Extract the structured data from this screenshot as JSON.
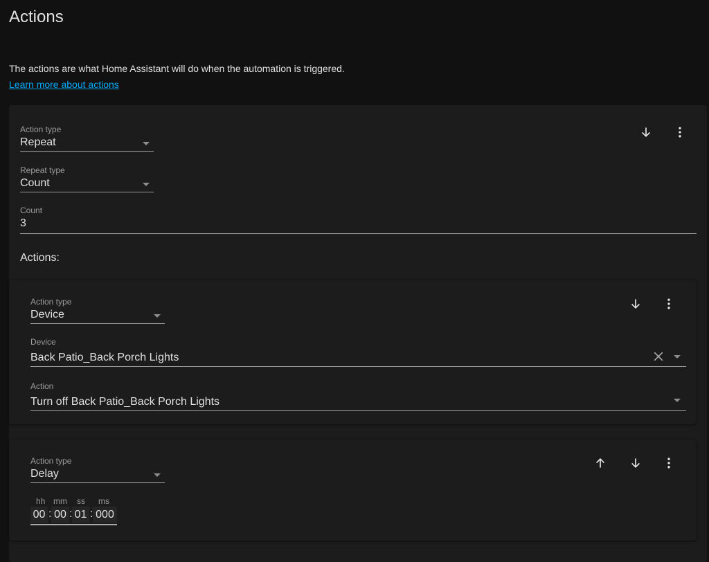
{
  "header": {
    "title": "Actions",
    "description": "The actions are what Home Assistant will do when the automation is triggered.",
    "learn_more_link": "Learn more about actions"
  },
  "colors": {
    "background": "#111111",
    "card": "#1c1c1c",
    "link": "#03a9f4",
    "text": "#e1e1e1",
    "label": "#9b9b9b"
  },
  "repeat_action": {
    "action_type_label": "Action type",
    "action_type_value": "Repeat",
    "repeat_type_label": "Repeat type",
    "repeat_type_value": "Count",
    "count_label": "Count",
    "count_value": "3",
    "actions_heading": "Actions:",
    "icons": [
      "arrow-down-icon",
      "more-vert-icon"
    ]
  },
  "sub_actions": [
    {
      "action_type_label": "Action type",
      "action_type_value": "Device",
      "device_label": "Device",
      "device_value": "Back Patio_Back Porch Lights",
      "action_label": "Action",
      "action_value": "Turn off Back Patio_Back Porch Lights",
      "icons": [
        "arrow-down-icon",
        "more-vert-icon",
        "clear-icon"
      ]
    },
    {
      "action_type_label": "Action type",
      "action_type_value": "Delay",
      "time_labels": {
        "hh": "hh",
        "mm": "mm",
        "ss": "ss",
        "ms": "ms"
      },
      "time_values": {
        "hh": "00",
        "mm": "00",
        "ss": "01",
        "ms": "000"
      },
      "separator": ":",
      "icons": [
        "arrow-up-icon",
        "arrow-down-icon",
        "more-vert-icon"
      ]
    }
  ]
}
